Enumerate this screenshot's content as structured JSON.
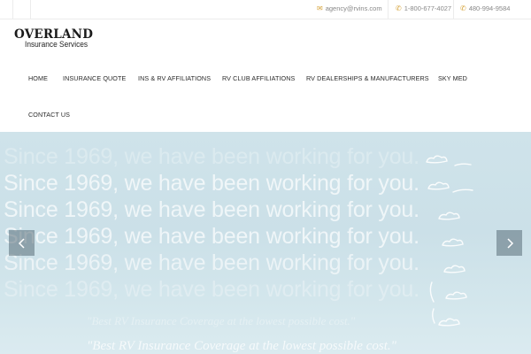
{
  "topbar": {
    "email": "agency@rvins.com",
    "phone1": "1-800-677-4027",
    "phone2": "480-994-9584"
  },
  "logo": {
    "main": "OVERLAND",
    "sub": "Insurance Services"
  },
  "nav": {
    "items": [
      {
        "label": "HOME"
      },
      {
        "label": "INSURANCE QUOTE"
      },
      {
        "label": "INS & RV AFFILIATIONS"
      },
      {
        "label": "RV CLUB AFFILIATIONS"
      },
      {
        "label": "RV DEALERSHIPS & MANUFACTURERS"
      },
      {
        "label": "SKY MED"
      },
      {
        "label": "CONTACT US"
      }
    ]
  },
  "hero": {
    "headline": "Since 1969, we have been working for you.",
    "tagline": "\"Best RV Insurance Coverage at the lowest possible cost.\""
  },
  "colors": {
    "accent": "#d6a33a",
    "hero_bg": "#cde2e9"
  }
}
